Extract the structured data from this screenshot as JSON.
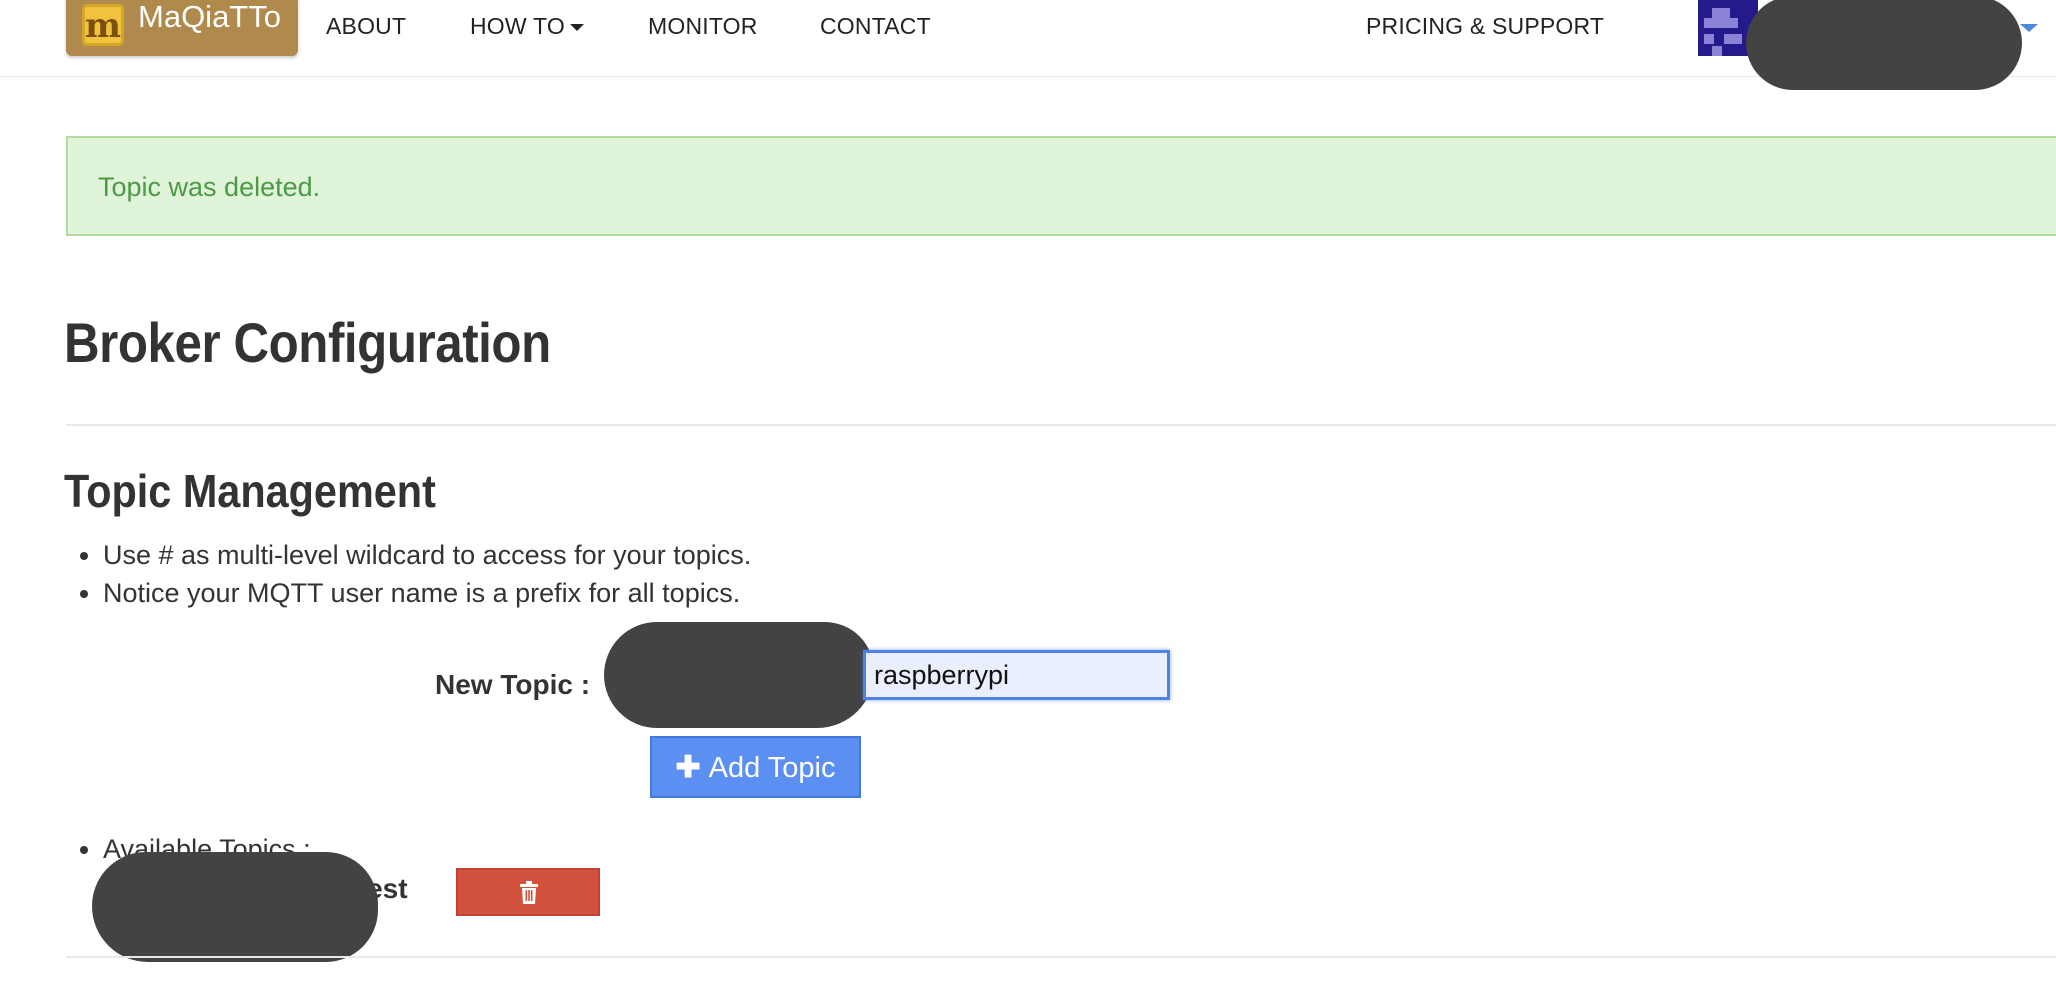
{
  "navbar": {
    "brand_logo_letter": "m",
    "brand_name": "MaQiaTTo",
    "items": [
      {
        "label": "ABOUT"
      },
      {
        "label": "HOW TO"
      },
      {
        "label": "MONITOR"
      },
      {
        "label": "CONTACT"
      },
      {
        "label": "PRICING & SUPPORT"
      }
    ]
  },
  "alert": {
    "message": "Topic was deleted."
  },
  "page": {
    "title": "Broker Configuration",
    "section_title": "Topic Management",
    "notes": [
      "Use # as multi-level wildcard to access for your topics.",
      "Notice your MQTT user name is a prefix for all topics."
    ]
  },
  "form": {
    "new_topic_label": "New Topic :",
    "topic_value": "raspberrypi",
    "add_button_label": "Add Topic"
  },
  "topics": {
    "heading": "Available Topics :",
    "items": [
      {
        "name": "/test"
      }
    ]
  },
  "colors": {
    "brand": "#b08a4c",
    "alert_bg": "#dff4d8",
    "alert_text": "#4c9a45",
    "primary_button": "#5b8ff2",
    "danger_button": "#d2523e"
  },
  "icons": {
    "add": "plus-icon",
    "delete": "trash-icon",
    "dropdown": "chevron-down-icon"
  }
}
